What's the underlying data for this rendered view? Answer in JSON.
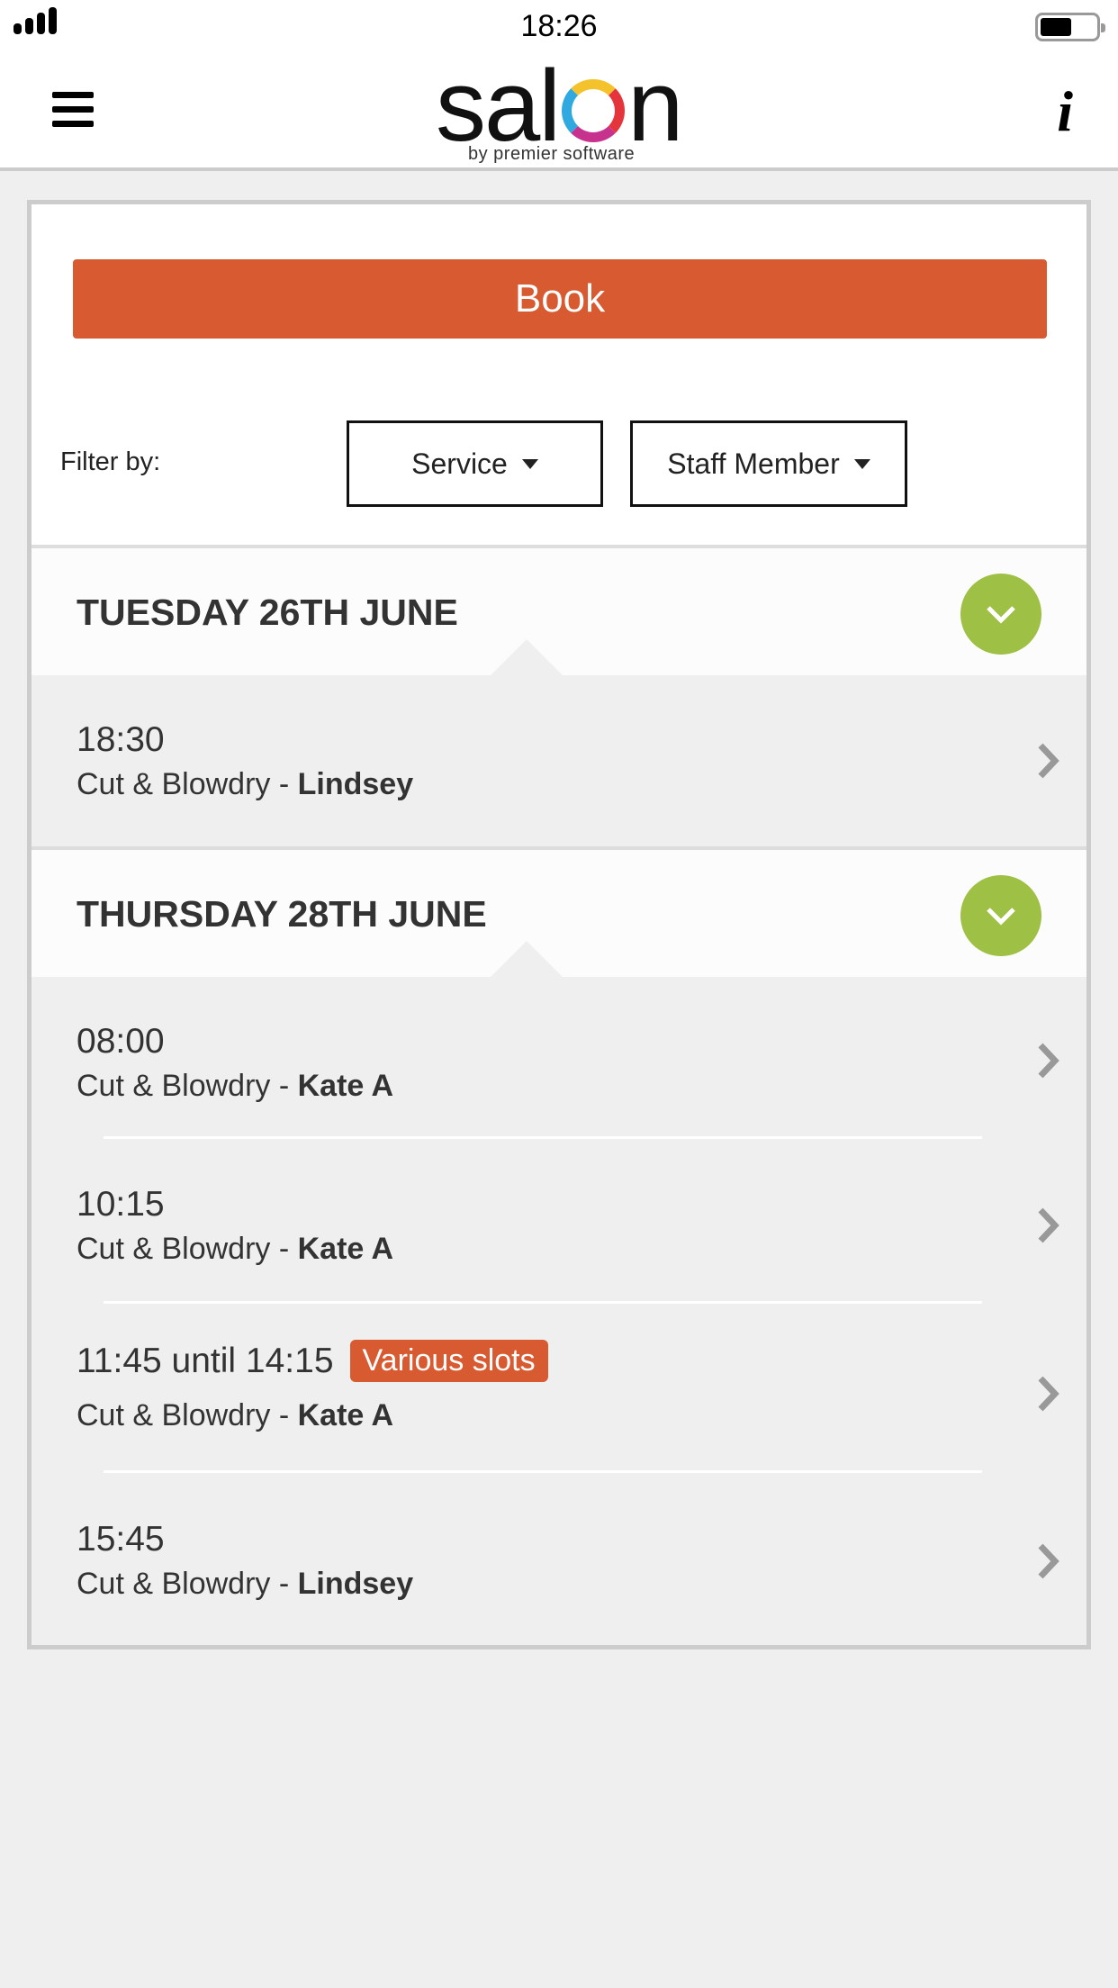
{
  "status_bar": {
    "time": "18:26"
  },
  "header": {
    "menu_icon": "hamburger-menu-icon",
    "logo_text": "salon",
    "logo_subtitle": "by premier software",
    "info_icon": "info-icon",
    "info_label": "i"
  },
  "book_button": {
    "label": "Book",
    "color": "#d85a31"
  },
  "filter": {
    "label": "Filter by:",
    "service": {
      "label": "Service"
    },
    "staff": {
      "label": "Staff Member"
    }
  },
  "days": [
    {
      "title": "TUESDAY 26TH JUNE",
      "slots": [
        {
          "time": "18:30",
          "service": "Cut & Blowdry - ",
          "staff": "Lindsey"
        }
      ]
    },
    {
      "title": "THURSDAY 28TH JUNE",
      "slots": [
        {
          "time": "08:00",
          "service": "Cut & Blowdry - ",
          "staff": "Kate A"
        },
        {
          "time": "10:15",
          "service": "Cut & Blowdry - ",
          "staff": "Kate A"
        },
        {
          "time": "11:45 until 14:15",
          "badge": "Various slots",
          "service": "Cut & Blowdry - ",
          "staff": "Kate A"
        },
        {
          "time": "15:45",
          "service": "Cut & Blowdry - ",
          "staff": "Lindsey"
        }
      ]
    }
  ],
  "colors": {
    "accent": "#d85a31",
    "toggle": "#9ec044"
  }
}
